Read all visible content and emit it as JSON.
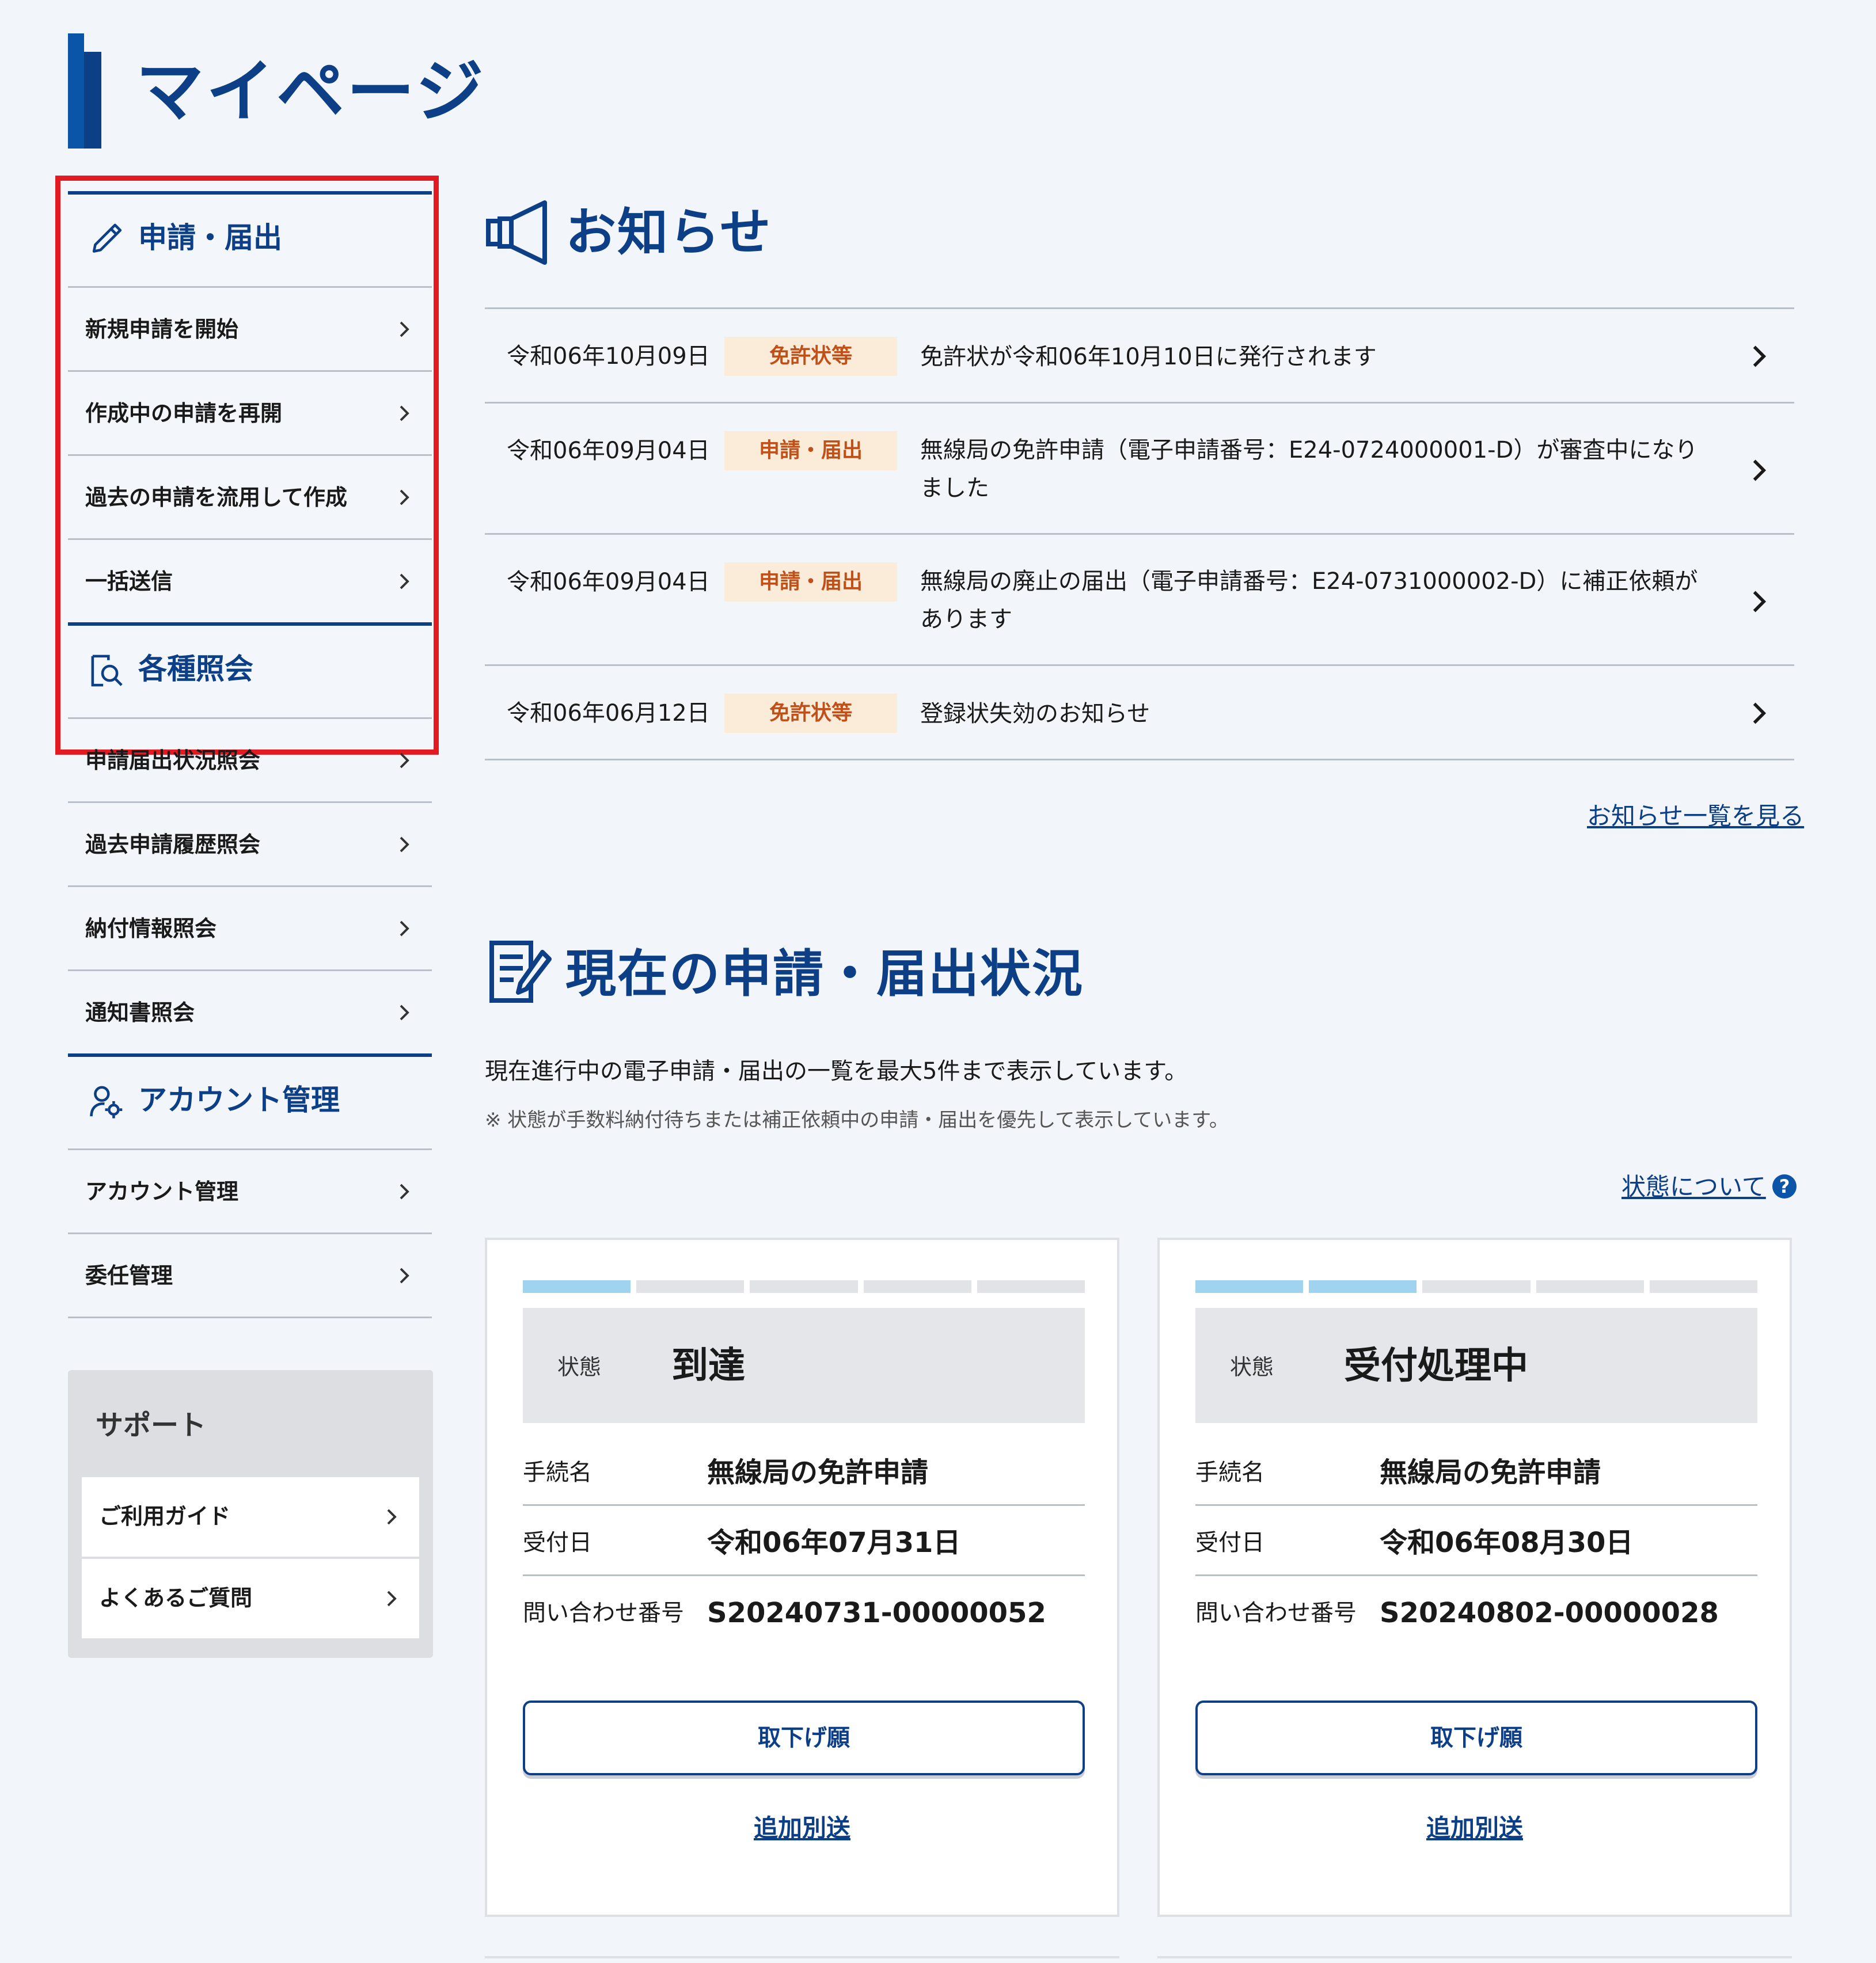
{
  "page_title": "マイページ",
  "sidebar": {
    "sections": [
      {
        "icon": "pencil-icon",
        "title": "申請・届出",
        "items": [
          "新規申請を開始",
          "作成中の申請を再開",
          "過去の申請を流用して作成",
          "一括送信"
        ]
      },
      {
        "icon": "document-search-icon",
        "title": "各種照会",
        "items": [
          "申請届出状況照会",
          "過去申請履歴照会",
          "納付情報照会",
          "通知書照会"
        ]
      },
      {
        "icon": "user-gear-icon",
        "title": "アカウント管理",
        "items": [
          "アカウント管理",
          "委任管理"
        ]
      }
    ]
  },
  "support": {
    "title": "サポート",
    "items": [
      "ご利用ガイド",
      "よくあるご質問"
    ]
  },
  "notices": {
    "title": "お知らせ",
    "icon": "megaphone-icon",
    "items": [
      {
        "date": "令和06年10月09日",
        "tag": "免許状等",
        "text": "免許状が令和06年10月10日に発行されます"
      },
      {
        "date": "令和06年09月04日",
        "tag": "申請・届出",
        "text": "無線局の免許申請（電子申請番号：E24-0724000001-D）が審査中になりました"
      },
      {
        "date": "令和06年09月04日",
        "tag": "申請・届出",
        "text": "無線局の廃止の届出（電子申請番号：E24-0731000002-D）に補正依頼があります"
      },
      {
        "date": "令和06年06月12日",
        "tag": "免許状等",
        "text": "登録状失効のお知らせ"
      }
    ],
    "view_all": "お知らせ一覧を見る"
  },
  "status": {
    "title": "現在の申請・届出状況",
    "icon": "document-pen-icon",
    "description": "現在進行中の電子申請・届出の一覧を最大5件まで表示しています。",
    "note": "※ 状態が手数料納付待ちまたは補正依頼中の申請・届出を優先して表示しています。",
    "about_link": "状態について",
    "labels": {
      "state": "状態",
      "procedure": "手続名",
      "received": "受付日",
      "inquiry": "問い合わせ番号"
    },
    "cards": [
      {
        "progress": 1,
        "steps": 5,
        "state": "到達",
        "procedure": "無線局の免許申請",
        "received": "令和06年07月31日",
        "inquiry": "S20240731-00000052",
        "withdraw": "取下げ願",
        "additional": "追加別送"
      },
      {
        "progress": 2,
        "steps": 5,
        "state": "受付処理中",
        "procedure": "無線局の免許申請",
        "received": "令和06年08月30日",
        "inquiry": "S20240802-00000028",
        "withdraw": "取下げ願",
        "additional": "追加別送"
      }
    ]
  },
  "colors": {
    "primary": "#0d3f87",
    "highlight_frame": "#e21b23",
    "tag_bg": "#fbecd9",
    "tag_text": "#c0501a",
    "progress_on": "#9fd3ef"
  }
}
